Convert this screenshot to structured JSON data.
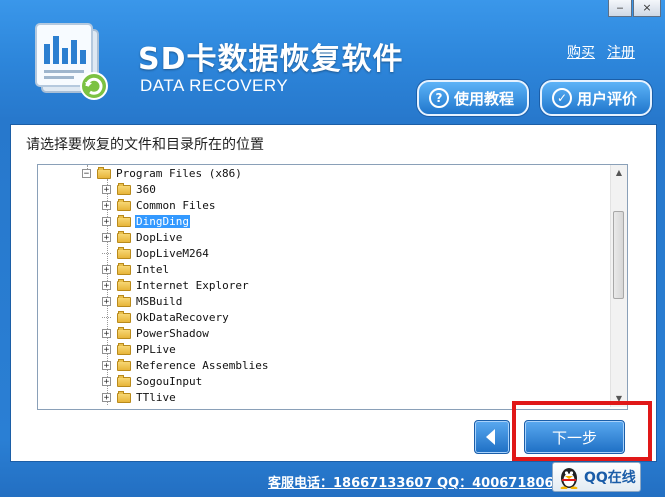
{
  "window": {
    "minimize_glyph": "‒",
    "close_glyph": "×"
  },
  "header": {
    "title": "SD卡数据恢复软件",
    "subtitle": "DATA RECOVERY",
    "links": {
      "buy": "购买",
      "register": "注册"
    },
    "tutorial_label": "使用教程",
    "review_label": "用户评价"
  },
  "main": {
    "prompt": "请选择要恢复的文件和目录所在的位置",
    "tree": {
      "parent": "Program Files (x86)",
      "items": [
        {
          "label": "360",
          "expandable": true
        },
        {
          "label": "Common Files",
          "expandable": true
        },
        {
          "label": "DingDing",
          "expandable": true,
          "selected": true
        },
        {
          "label": "DopLive",
          "expandable": true
        },
        {
          "label": "DopLiveM264",
          "expandable": false
        },
        {
          "label": "Intel",
          "expandable": true
        },
        {
          "label": "Internet Explorer",
          "expandable": true
        },
        {
          "label": "MSBuild",
          "expandable": true
        },
        {
          "label": "OkDataRecovery",
          "expandable": false
        },
        {
          "label": "PowerShadow",
          "expandable": true
        },
        {
          "label": "PPLive",
          "expandable": true
        },
        {
          "label": "Reference Assemblies",
          "expandable": true
        },
        {
          "label": "SogouInput",
          "expandable": true
        },
        {
          "label": "TTlive",
          "expandable": true
        }
      ]
    }
  },
  "buttons": {
    "back_glyph": "◀",
    "next_label": "下一步"
  },
  "footer": {
    "contact": "客服电话：18667133607 QQ：4006718068",
    "qq_label": "QQ在线"
  },
  "colors": {
    "accent": "#2a7fd4",
    "highlight": "#e01818",
    "selection": "#3399ff"
  }
}
